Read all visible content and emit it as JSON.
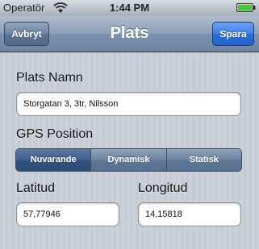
{
  "status_bar": {
    "carrier": "Operatör",
    "time": "1:44 PM",
    "icons": [
      "wifi-icon",
      "battery-icon"
    ]
  },
  "nav": {
    "back_label": "Avbryt",
    "title": "Plats",
    "save_label": "Spara"
  },
  "form": {
    "name_label": "Plats Namn",
    "name_value": "Storgatan 3, 3tr, Nilsson",
    "gps_label": "GPS Position",
    "gps_options": [
      "Nuvarande",
      "Dynamisk",
      "Statisk"
    ],
    "gps_selected": "Nuvarande",
    "lat_label": "Latitud",
    "lat_value": "57,77946",
    "lon_label": "Longitud",
    "lon_value": "14,15818"
  },
  "colors": {
    "nav_bar": "#6d84a2",
    "save_button": "#2a6ddb",
    "background": "#c5ccd4"
  }
}
